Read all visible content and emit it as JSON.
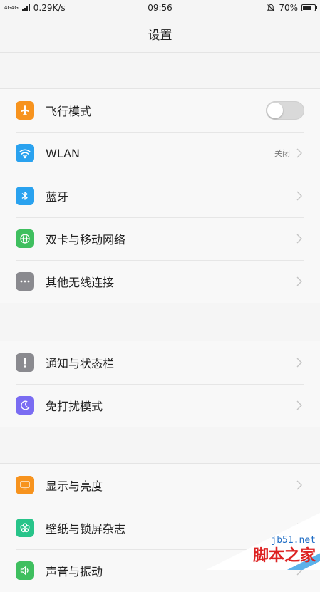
{
  "status_bar": {
    "network": "4G4G",
    "speed": "0.29K/s",
    "time": "09:56",
    "battery": "70%",
    "battery_level": 0.7
  },
  "header": {
    "title": "设置"
  },
  "groups": [
    {
      "items": [
        {
          "label": "飞行模式",
          "icon": "airplane-icon",
          "color": "#f7931e",
          "toggle": false
        },
        {
          "label": "WLAN",
          "icon": "wifi-icon",
          "color": "#2aa2ef",
          "status": "关闭"
        },
        {
          "label": "蓝牙",
          "icon": "bluetooth-icon",
          "color": "#2aa2ef"
        },
        {
          "label": "双卡与移动网络",
          "icon": "globe-icon",
          "color": "#3fbf5f"
        },
        {
          "label": "其他无线连接",
          "icon": "more-icon",
          "color": "#8a8a8f"
        }
      ]
    },
    {
      "items": [
        {
          "label": "通知与状态栏",
          "icon": "exclamation-icon",
          "color": "#8a8a8f"
        },
        {
          "label": "免打扰模式",
          "icon": "moon-icon",
          "color": "#7a6cf2"
        }
      ]
    },
    {
      "items": [
        {
          "label": "显示与亮度",
          "icon": "monitor-icon",
          "color": "#f7931e"
        },
        {
          "label": "壁纸与锁屏杂志",
          "icon": "flower-icon",
          "color": "#28c48a"
        },
        {
          "label": "声音与振动",
          "icon": "speaker-icon",
          "color": "#3fbf5f"
        }
      ]
    }
  ],
  "watermark": {
    "site": "jb51.net",
    "name": "脚本之家"
  }
}
